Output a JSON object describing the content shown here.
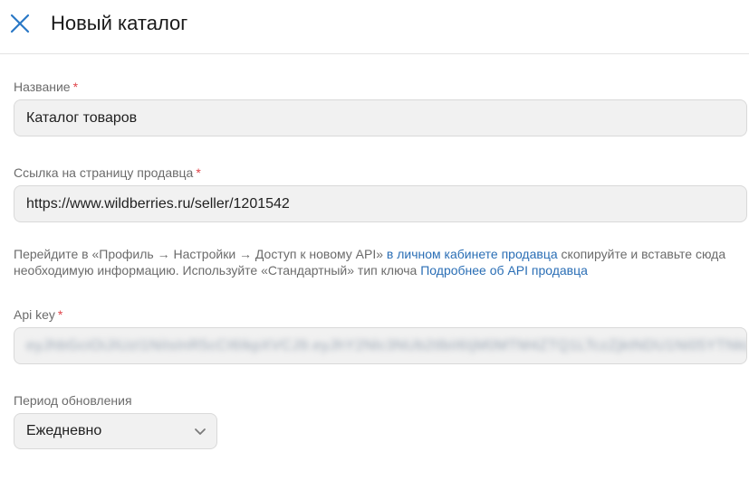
{
  "header": {
    "title": "Новый каталог",
    "close_icon": "close-icon"
  },
  "form": {
    "name": {
      "label": "Название",
      "required_mark": "*",
      "value": "Каталог товаров"
    },
    "seller_link": {
      "label": "Ссылка на страницу продавца",
      "required_mark": "*",
      "value": "https://www.wildberries.ru/seller/1201542"
    },
    "hint": {
      "text_1": "Перейдите в «Профиль → Настройки → Доступ к новому API»",
      "link_1": "в личном кабинете продавца",
      "text_2": "скопируйте и вставьте сюда необходимую информацию. Используйте «Стандартный» тип ключа",
      "link_2": "Подробнее об API продавца"
    },
    "api_key": {
      "label": "Api key",
      "required_mark": "*",
      "value": "eyJhbGciOiJIUzI1NiIsInR5cCI6IkpXVCJ9.eyJhY2Nlc3NUb2tlbiI6IjM0MTM4ZTQ1LTczZjktNDU1Ni05YTNkLWFmOTY0ZjA"
    },
    "refresh_period": {
      "label": "Период обновления",
      "selected": "Ежедневно",
      "chevron_icon": "chevron-down-icon"
    }
  },
  "colors": {
    "accent_link": "#2a6eb5",
    "close_icon": "#2a78c6",
    "required": "#e0444a",
    "field_bg": "#f1f1f1"
  }
}
